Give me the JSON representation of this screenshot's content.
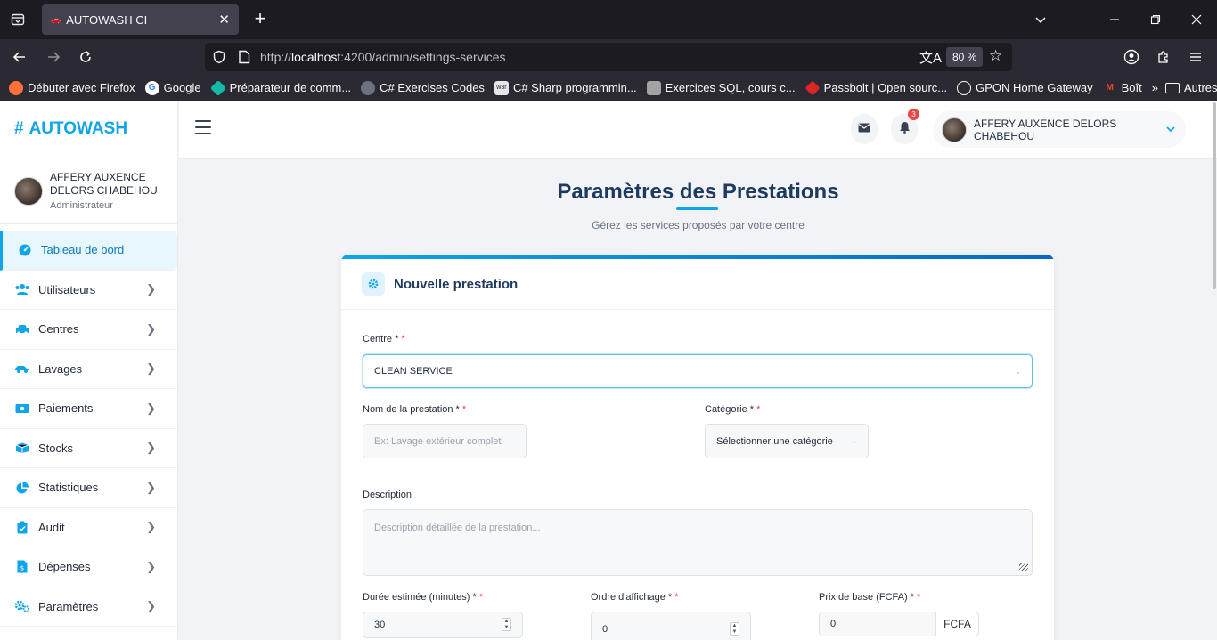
{
  "browser": {
    "tab_title": "AUTOWASH CI",
    "url_prefix": "http://",
    "url_host": "localhost",
    "url_rest": ":4200/admin/settings-services",
    "zoom": "80 %",
    "bookmarks": [
      {
        "label": "Débuter avec Firefox",
        "color": "#ff7139"
      },
      {
        "label": "Google",
        "color": "#4285f4"
      },
      {
        "label": "Préparateur de comm...",
        "color": "#14b8a6"
      },
      {
        "label": "C# Exercises Codes",
        "color": "#6b7280"
      },
      {
        "label": "C# Sharp programmin...",
        "color": "#e5e7eb"
      },
      {
        "label": "Exercices SQL, cours c...",
        "color": "#a3a3a3"
      },
      {
        "label": "Passbolt | Open sourc...",
        "color": "#dc2626"
      },
      {
        "label": "GPON Home Gateway",
        "color": "#9ca3af"
      },
      {
        "label": "Boît",
        "color": "#ea4335"
      }
    ],
    "other_bookmarks": "Autres marque-pages"
  },
  "app": {
    "brand": "AUTOWASH",
    "brand_prefix": "#",
    "user": {
      "name": "AFFERY AUXENCE DELORS CHABEHOU",
      "role": "Administrateur"
    },
    "notifications_count": "3",
    "menu": [
      {
        "label": "Tableau de bord",
        "icon": "dashboard-icon",
        "active": true
      },
      {
        "label": "Utilisateurs",
        "icon": "users-icon"
      },
      {
        "label": "Centres",
        "icon": "car-icon"
      },
      {
        "label": "Lavages",
        "icon": "car-side-icon"
      },
      {
        "label": "Paiements",
        "icon": "money-icon"
      },
      {
        "label": "Stocks",
        "icon": "boxes-icon"
      },
      {
        "label": "Statistiques",
        "icon": "pie-chart-icon"
      },
      {
        "label": "Audit",
        "icon": "clipboard-check-icon"
      },
      {
        "label": "Dépenses",
        "icon": "invoice-icon"
      },
      {
        "label": "Paramètres",
        "icon": "cogs-icon"
      }
    ]
  },
  "page": {
    "title": "Paramètres des Prestations",
    "subtitle": "Gérez les services proposés par votre centre",
    "card_title": "Nouvelle prestation"
  },
  "form": {
    "centre_label": "Centre *",
    "centre_value": "CLEAN SERVICE",
    "name_label": "Nom de la prestation *",
    "name_placeholder": "Ex: Lavage extérieur complet",
    "category_label": "Catégorie *",
    "category_placeholder": "Sélectionner une catégorie",
    "description_label": "Description",
    "description_placeholder": "Description détaillée de la prestation...",
    "duration_label": "Durée estimée (minutes) *",
    "duration_value": "30",
    "order_label": "Ordre d'affichage *",
    "order_value": "0",
    "price_label": "Prix de base (FCFA) *",
    "price_value": "0",
    "price_addon": "FCFA",
    "required_mark": "*"
  }
}
